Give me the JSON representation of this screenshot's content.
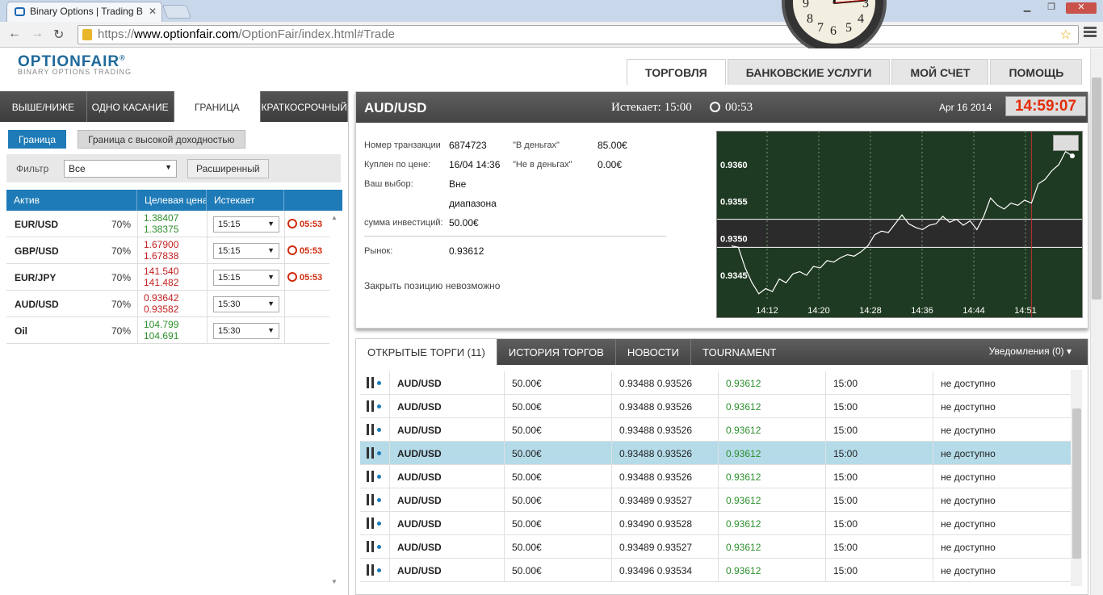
{
  "browser": {
    "tab_title": "Binary Options | Trading B",
    "url_scheme": "https://",
    "url_host": "www.optionfair.com",
    "url_path": "/OptionFair/index.html#Trade"
  },
  "site": {
    "logo": "OPTIONFAIR",
    "logo_mark": "®",
    "tagline": "BINARY OPTIONS TRADING",
    "nav": [
      "ТОРГОВЛЯ",
      "БАНКОВСКИЕ УСЛУГИ",
      "МОЙ СЧЕТ",
      "ПОМОЩЬ"
    ]
  },
  "left": {
    "tabs": [
      "ВЫШЕ/НИЖЕ",
      "ОДНО КАСАНИЕ",
      "ГРАНИЦА",
      "КРАТКОСРОЧНЫЙ"
    ],
    "subtabs": [
      "Граница",
      "Граница с высокой доходностью"
    ],
    "filter_label": "Фильтр",
    "filter_value": "Все",
    "advanced_label": "Расширенный",
    "columns": [
      "Актив",
      "Целевая цена",
      "Истекает",
      ""
    ],
    "assets": [
      {
        "name": "EUR/USD",
        "pct": "70%",
        "high": "1.38407",
        "low": "1.38375",
        "color": "green",
        "expiry": "15:15",
        "countdown": "05:53"
      },
      {
        "name": "GBP/USD",
        "pct": "70%",
        "high": "1.67900",
        "low": "1.67838",
        "color": "red",
        "expiry": "15:15",
        "countdown": "05:53"
      },
      {
        "name": "EUR/JPY",
        "pct": "70%",
        "high": "141.540",
        "low": "141.482",
        "color": "red",
        "expiry": "15:15",
        "countdown": "05:53"
      },
      {
        "name": "AUD/USD",
        "pct": "70%",
        "high": "0.93642",
        "low": "0.93582",
        "color": "red",
        "expiry": "15:30",
        "countdown": ""
      },
      {
        "name": "Oil",
        "pct": "70%",
        "high": "104.799",
        "low": "104.691",
        "color": "green",
        "expiry": "15:30",
        "countdown": ""
      }
    ]
  },
  "trade": {
    "pair": "AUD/USD",
    "expires_label": "Истекает:",
    "expires_value": "15:00",
    "timer": "00:53",
    "date": "Apr 16 2014",
    "clock": "14:59:07",
    "labels": {
      "txn": "Номер транзакции",
      "bought": "Куплен по цене:",
      "choice": "Ваш выбор:",
      "invest": "сумма инвестиций:",
      "itm": "\"В деньгах\"",
      "otm": "\"Не в деньгах\"",
      "market": "Рынок:"
    },
    "values": {
      "txn": "6874723",
      "bought": "16/04 14:36",
      "choice1": "Вне",
      "choice2": "диапазона",
      "invest": "50.00€",
      "itm": "85.00€",
      "otm": "0.00€",
      "market": "0.93612"
    },
    "close_note": "Закрыть позицию невозможно"
  },
  "chart_data": {
    "type": "line",
    "x_ticks": [
      "14:12",
      "14:20",
      "14:28",
      "14:36",
      "14:44",
      "14:51"
    ],
    "y_ticks": [
      "0.9360",
      "0.9355",
      "0.9350",
      "0.9345"
    ],
    "ylim": [
      0.93415,
      0.93645
    ],
    "band": [
      0.93526,
      0.93488
    ],
    "series": [
      {
        "x": [
          0,
          1,
          2,
          3,
          4,
          5,
          6,
          7,
          8,
          9,
          10,
          11,
          12,
          13,
          14,
          15,
          16,
          17,
          18,
          19,
          20,
          21,
          22,
          23,
          24,
          25,
          26,
          27,
          28,
          29,
          30,
          31,
          32,
          33,
          34,
          35,
          36,
          37,
          38,
          39,
          40,
          41,
          42,
          43,
          44,
          45,
          46,
          47,
          48,
          49,
          50
        ],
        "values": [
          0.9349,
          0.93488,
          0.9346,
          0.9344,
          0.93425,
          0.93432,
          0.93428,
          0.93445,
          0.9344,
          0.93452,
          0.93455,
          0.9345,
          0.93462,
          0.9346,
          0.9347,
          0.93468,
          0.93474,
          0.93478,
          0.93476,
          0.93482,
          0.9349,
          0.93505,
          0.9351,
          0.93508,
          0.9352,
          0.93532,
          0.9352,
          0.93515,
          0.93512,
          0.93518,
          0.9352,
          0.9353,
          0.93522,
          0.93526,
          0.93518,
          0.93524,
          0.93512,
          0.9353,
          0.93555,
          0.93545,
          0.9354,
          0.93548,
          0.93545,
          0.93552,
          0.93548,
          0.93574,
          0.9358,
          0.93592,
          0.936,
          0.93618,
          0.93612
        ]
      }
    ],
    "marker_x": 44
  },
  "bottom": {
    "tabs": [
      "ОТКРЫТЫЕ ТОРГИ (11)",
      "ИСТОРИЯ ТОРГОВ",
      "НОВОСТИ",
      "TOURNAMENT"
    ],
    "notifications": "Уведомления (0)",
    "trades": [
      {
        "pair": "AUD/USD",
        "amount": "50.00€",
        "range": "0.93488 0.93526",
        "market": "0.93612",
        "expiry": "15:00",
        "status": "не доступно"
      },
      {
        "pair": "AUD/USD",
        "amount": "50.00€",
        "range": "0.93488 0.93526",
        "market": "0.93612",
        "expiry": "15:00",
        "status": "не доступно"
      },
      {
        "pair": "AUD/USD",
        "amount": "50.00€",
        "range": "0.93488 0.93526",
        "market": "0.93612",
        "expiry": "15:00",
        "status": "не доступно"
      },
      {
        "pair": "AUD/USD",
        "amount": "50.00€",
        "range": "0.93488 0.93526",
        "market": "0.93612",
        "expiry": "15:00",
        "status": "не доступно",
        "selected": true
      },
      {
        "pair": "AUD/USD",
        "amount": "50.00€",
        "range": "0.93488 0.93526",
        "market": "0.93612",
        "expiry": "15:00",
        "status": "не доступно"
      },
      {
        "pair": "AUD/USD",
        "amount": "50.00€",
        "range": "0.93489 0.93527",
        "market": "0.93612",
        "expiry": "15:00",
        "status": "не доступно"
      },
      {
        "pair": "AUD/USD",
        "amount": "50.00€",
        "range": "0.93490 0.93528",
        "market": "0.93612",
        "expiry": "15:00",
        "status": "не доступно"
      },
      {
        "pair": "AUD/USD",
        "amount": "50.00€",
        "range": "0.93489 0.93527",
        "market": "0.93612",
        "expiry": "15:00",
        "status": "не доступно"
      },
      {
        "pair": "AUD/USD",
        "amount": "50.00€",
        "range": "0.93496 0.93534",
        "market": "0.93612",
        "expiry": "15:00",
        "status": "не доступно"
      }
    ]
  },
  "colors": {
    "accent": "#1e7bb7",
    "up": "#2c8f2c",
    "down": "#c42020",
    "clock_red": "#e32d0a",
    "chart_bg": "#1f3a22"
  }
}
